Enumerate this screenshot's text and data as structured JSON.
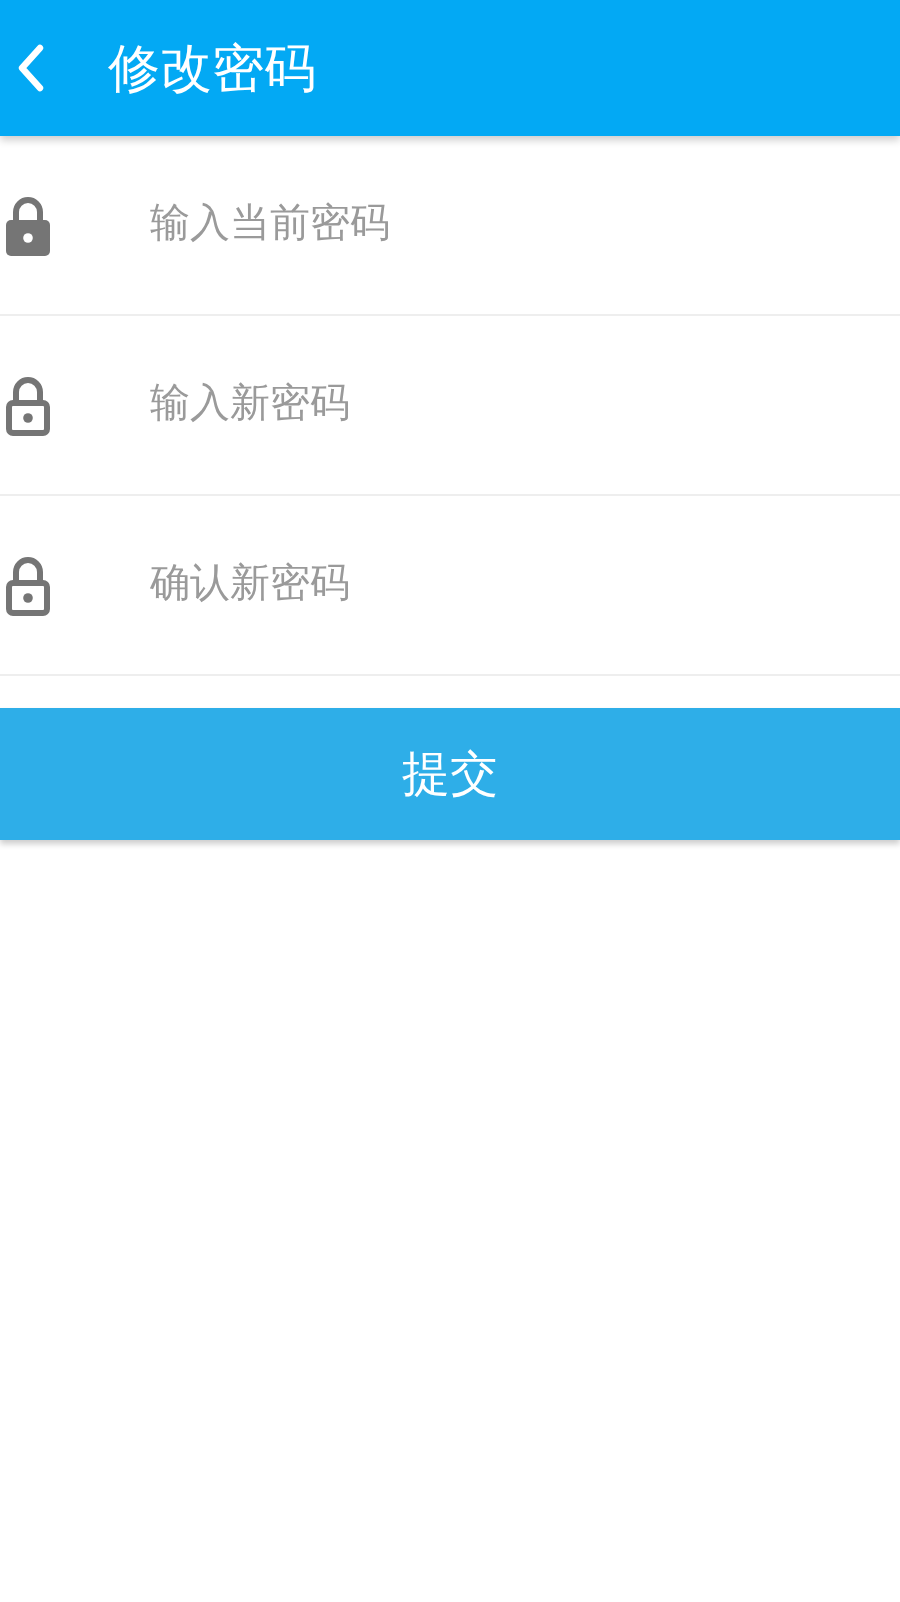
{
  "header": {
    "title": "修改密码"
  },
  "fields": [
    {
      "kind": "filled",
      "placeholder": "输入当前密码"
    },
    {
      "kind": "outline",
      "placeholder": "输入新密码"
    },
    {
      "kind": "outline",
      "placeholder": "确认新密码"
    }
  ],
  "submit_button": "提交"
}
